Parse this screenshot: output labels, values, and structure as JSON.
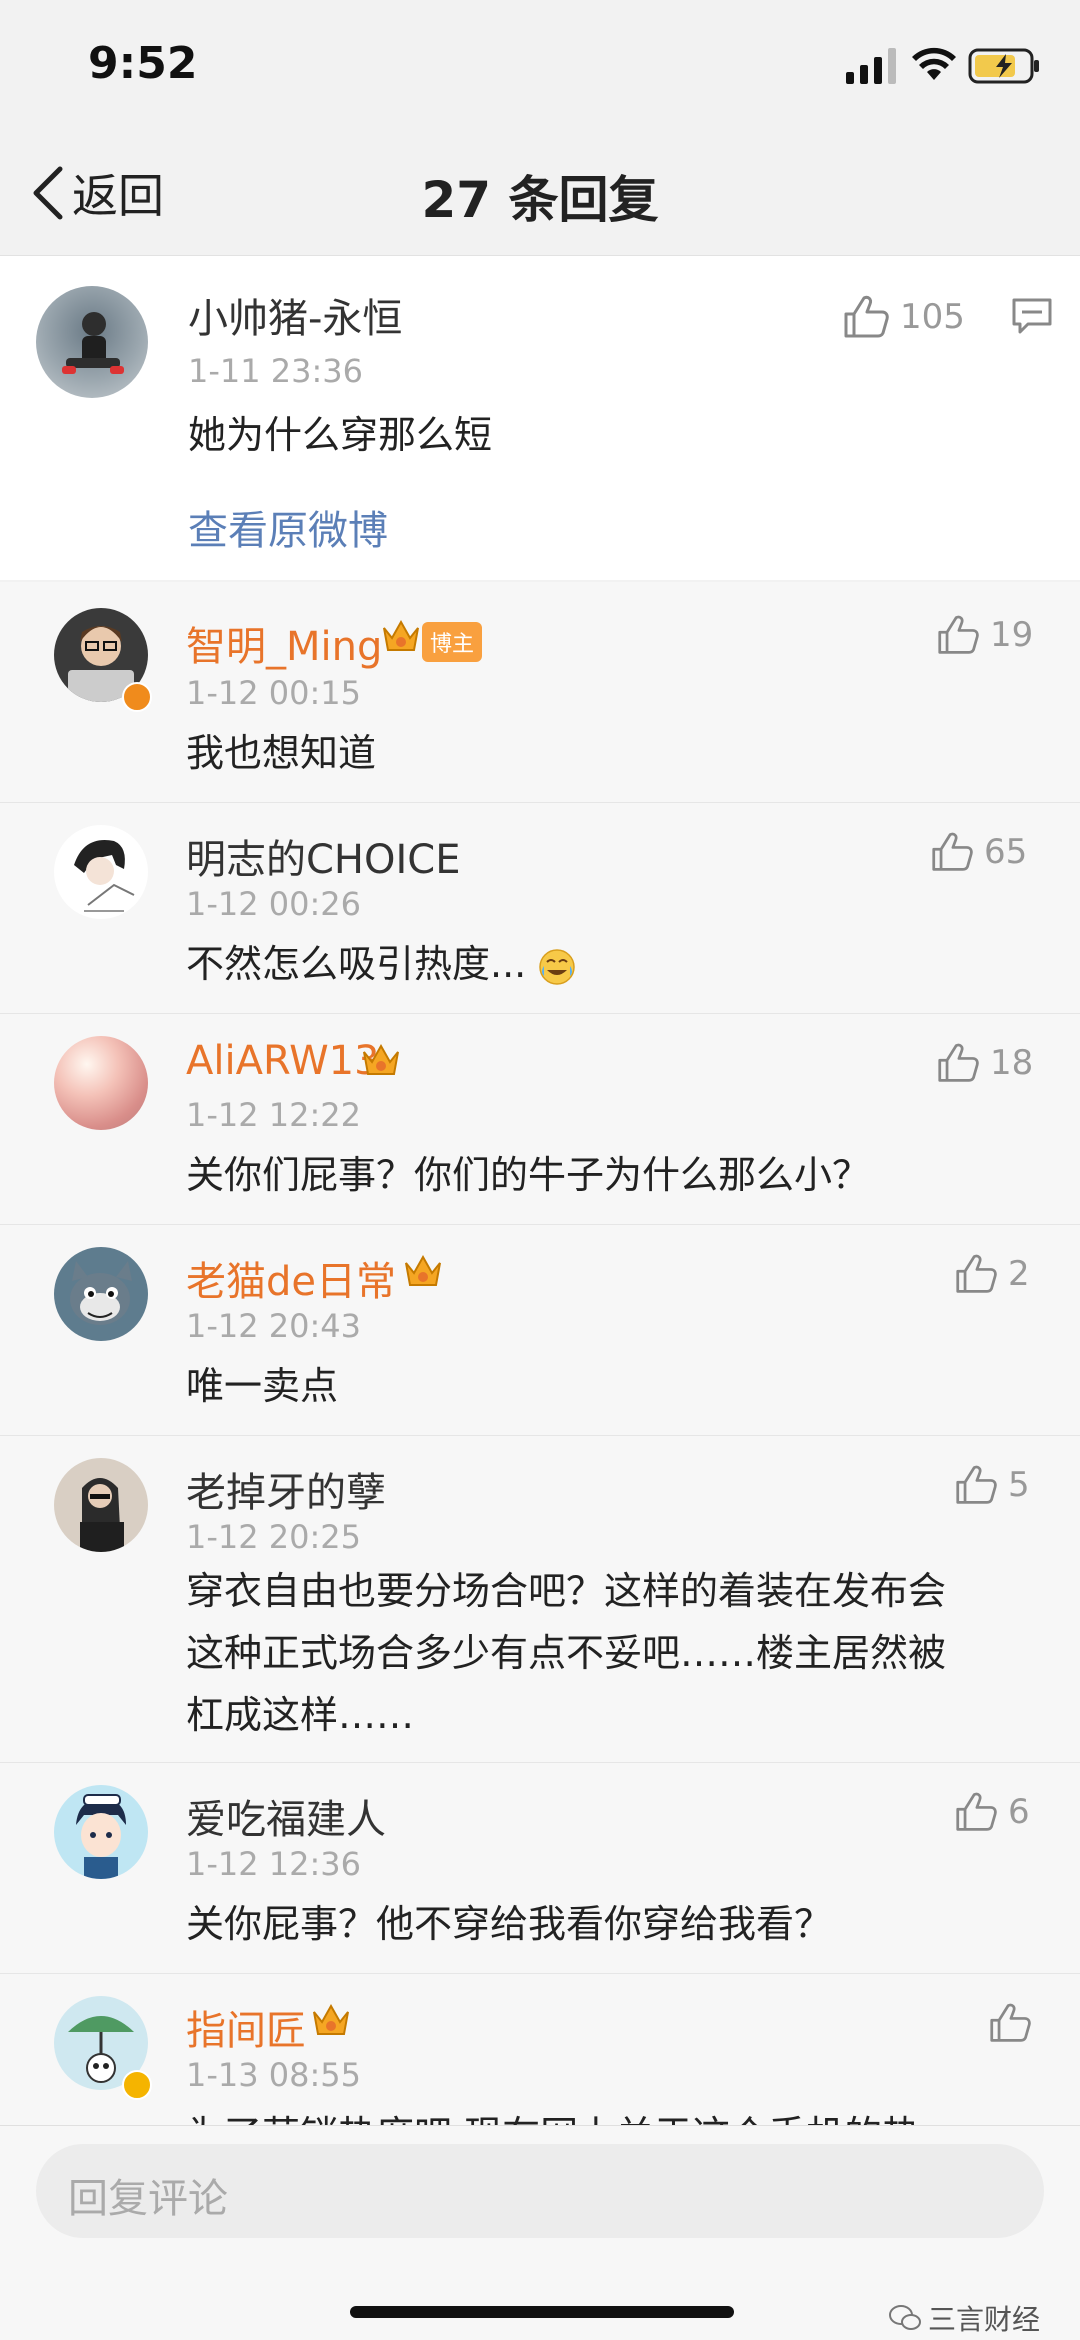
{
  "status_bar": {
    "time": "9:52"
  },
  "nav": {
    "back_label": "返回",
    "title": "27 条回复"
  },
  "main_comment": {
    "username": "小帅猪-永恒",
    "timestamp": "1-11 23:36",
    "text": "她为什么穿那么短",
    "likes": "105",
    "view_original": "查看原微博"
  },
  "replies": [
    {
      "username": "智明_Ming",
      "timestamp": "1-12 00:15",
      "text": "我也想知道",
      "likes": "19",
      "badge": "博主"
    },
    {
      "username": "明志的CHOICE",
      "timestamp": "1-12 00:26",
      "text": "不然怎么吸引热度...",
      "likes": "65"
    },
    {
      "username": "AliARW13",
      "timestamp": "1-12 12:22",
      "text": "关你们屁事？你们的牛子为什么那么小？",
      "likes": "18"
    },
    {
      "username": "老猫de日常",
      "timestamp": "1-12 20:43",
      "text": "唯一卖点",
      "likes": "2"
    },
    {
      "username": "老掉牙的孽",
      "timestamp": "1-12 20:25",
      "text_lines": [
        "穿衣自由也要分场合吧？这样的着装在发布会",
        "这种正式场合多少有点不妥吧……楼主居然被",
        "杠成这样……"
      ],
      "likes": "5"
    },
    {
      "username": "爱吃福建人",
      "timestamp": "1-12 12:36",
      "text": "关你屁事？他不穿给我看你穿给我看？",
      "likes": "6"
    },
    {
      "username": "指间匠",
      "timestamp": "1-13 08:55",
      "text": "为了营销热度吧 现在网上关于这个手机的热",
      "likes": ""
    }
  ],
  "input": {
    "placeholder": "回复评论"
  },
  "watermark": {
    "text": "三言财经"
  },
  "colors": {
    "vip_name": "#e8742a",
    "link": "#5b7fb7",
    "badge": "#f9a03f"
  }
}
